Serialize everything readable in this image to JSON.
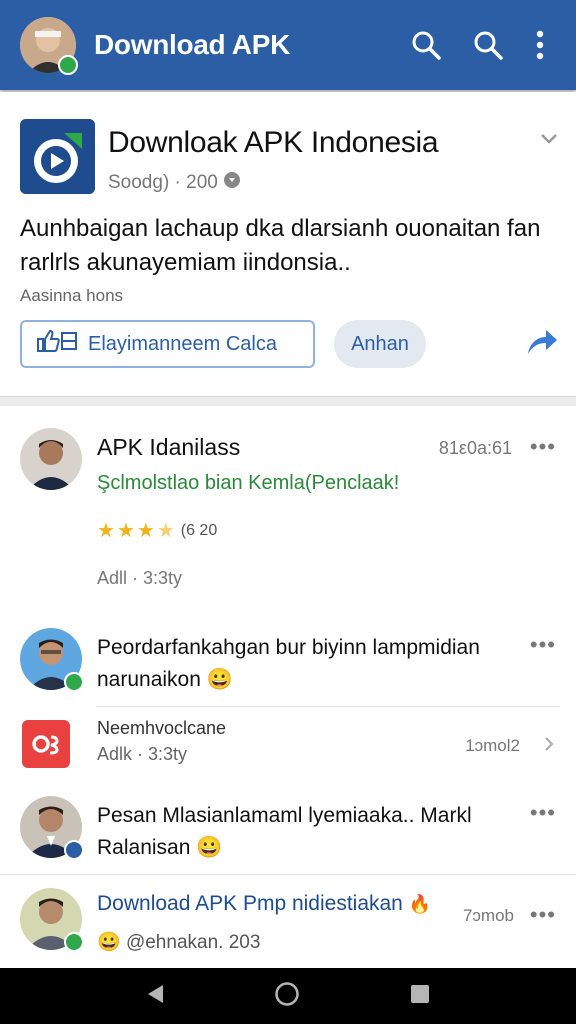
{
  "topbar": {
    "title": "Download APK",
    "icons": [
      "search-icon",
      "search-icon",
      "more-vert-icon"
    ]
  },
  "app_card": {
    "title": "Downloak APK Indonesia",
    "meta": "Soodg) · 200",
    "description": "Aunhbaigan lachaup dka dlarsianh ouonaitan fan rarlrls akunayemiam iindonsia..",
    "sub": "Aasinna hons",
    "primary_button": "Elayimanneem Calca",
    "secondary_button": "Anhan"
  },
  "feed": {
    "post1": {
      "name": "APK Idanilass",
      "time": "81ε0a:61",
      "subtitle": "Şclmolstlao bian Kemla(Penclaak!",
      "rating_text": "(6 20",
      "meta": "Adll · 3:3ty"
    },
    "post2": {
      "text": "Peordarfankahgan bur biyinn lampmidian narunaikon",
      "emoji": "😀"
    },
    "post3": {
      "name": "Neemhvoclcane",
      "meta": "Adlk · 3:3ty",
      "time": "1ɔmol2"
    },
    "post4": {
      "text": "Pesan Mlasianlamaml lyemiaaka.. Markl Ralanisan",
      "emoji": "😀"
    },
    "post5": {
      "title": "Download APK",
      "title_rest": "Pmp nidiestiakan",
      "emoji_title": "🔥",
      "time": "7ɔmob",
      "sub": "@ehnakan. 203",
      "emoji": "😀"
    }
  },
  "colors": {
    "brand": "#2c5ea6",
    "green_link": "#2a8a3a",
    "star": "#f2b41c",
    "red": "#e8413f"
  }
}
